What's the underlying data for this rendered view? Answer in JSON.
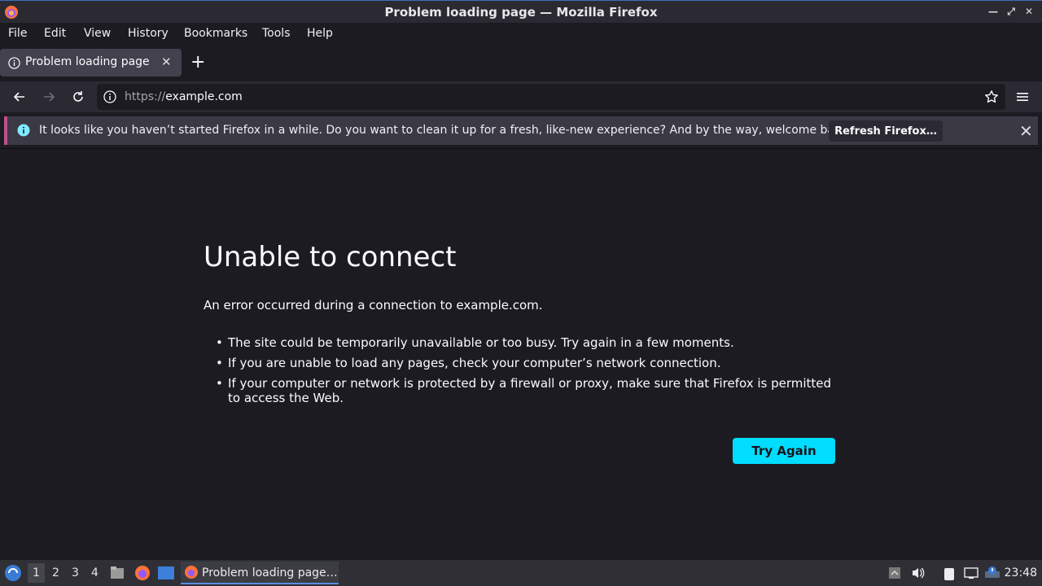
{
  "window": {
    "title": "Problem loading page — Mozilla Firefox"
  },
  "menu": {
    "file": "File",
    "edit": "Edit",
    "view": "View",
    "history": "History",
    "bookmarks": "Bookmarks",
    "tools": "Tools",
    "help": "Help"
  },
  "tab": {
    "title": "Problem loading page",
    "close_icon": "close-icon"
  },
  "urlbar": {
    "scheme": "https://",
    "host": "example.com"
  },
  "notification": {
    "text": "It looks like you haven’t started Firefox in a while. Do you want to clean it up for a fresh, like-new experience? And by the way, welcome back!",
    "button": "Refresh Firefox…"
  },
  "error": {
    "title": "Unable to connect",
    "description": "An error occurred during a connection to example.com.",
    "items": [
      "The site could be temporarily unavailable or too busy. Try again in a few moments.",
      "If you are unable to load any pages, check your computer’s network connection.",
      "If your computer or network is protected by a firewall or proxy, make sure that Firefox is permitted to access the Web."
    ],
    "button": "Try Again"
  },
  "taskbar": {
    "workspaces": [
      "1",
      "2",
      "3",
      "4"
    ],
    "active_window": "Problem loading page…",
    "clock": "23:48"
  },
  "colors": {
    "accent": "#00ddff",
    "notification_border": "#c0508c",
    "background": "#1c1b22"
  }
}
